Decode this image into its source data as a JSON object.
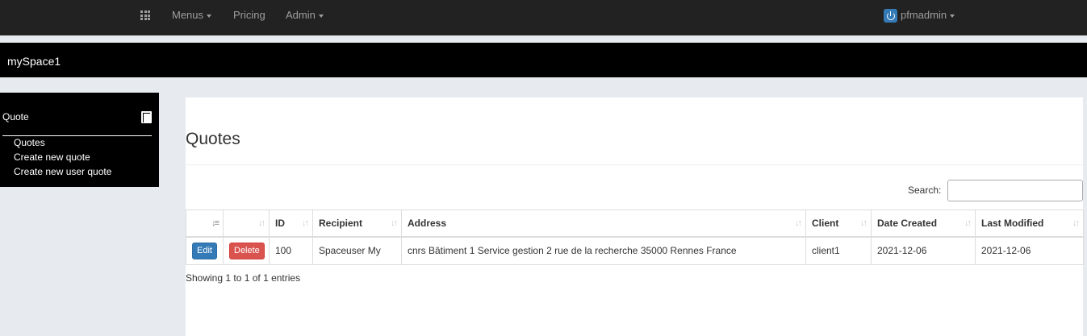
{
  "topnav": {
    "apps_icon": "grid-apps-icon",
    "menus_label": "Menus",
    "pricing_label": "Pricing",
    "admin_label": "Admin",
    "user_label": "pfmadmin",
    "user_icon": "power-icon"
  },
  "space": {
    "title": "mySpace1"
  },
  "sidebar": {
    "heading": "Quote",
    "heading_icon": "book-icon",
    "links": [
      "Quotes",
      "Create new quote",
      "Create new user quote"
    ]
  },
  "main": {
    "title": "Quotes",
    "search_label": "Search:",
    "search_value": "",
    "table": {
      "columns": [
        "",
        "",
        "ID",
        "Recipient",
        "Address",
        "Client",
        "Date Created",
        "Last Modified"
      ],
      "rows": [
        {
          "edit_label": "Edit",
          "delete_label": "Delete",
          "id": "100",
          "recipient": "Spaceuser My",
          "address": "cnrs Bâtiment 1 Service gestion 2 rue de la recherche 35000 Rennes France",
          "client": "client1",
          "date_created": "2021-12-06",
          "last_modified": "2021-12-06"
        }
      ]
    },
    "info": "Showing 1 to 1 of 1 entries"
  },
  "colors": {
    "navbar": "#222222",
    "spacebar": "#000000",
    "background": "#e7ebef",
    "edit_button": "#337ab7",
    "delete_button": "#d9534f"
  }
}
